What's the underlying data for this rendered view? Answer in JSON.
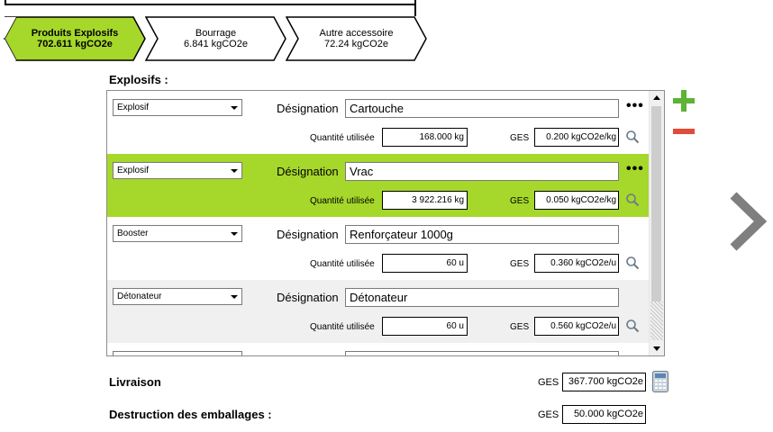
{
  "breadcrumbs": [
    {
      "title": "Produits Explosifs",
      "value": "702.611 kgCO2e",
      "active": true
    },
    {
      "title": "Bourrage",
      "value": "6.841 kgCO2e",
      "active": false
    },
    {
      "title": "Autre accessoire",
      "value": "72.24 kgCO2e",
      "active": false
    }
  ],
  "explosifs": {
    "title": "Explosifs :",
    "designation_label": "Désignation",
    "quantity_label": "Quantité utilisée",
    "ges_label": "GES",
    "more_label": "•••",
    "rows": [
      {
        "type": "Explosif",
        "designation": "Cartouche",
        "quantity": "168.000 kg",
        "ges": "0.200 kgCO2e/kg",
        "style": "white"
      },
      {
        "type": "Explosif",
        "designation": "Vrac",
        "quantity": "3 922.216 kg",
        "ges": "0.050 kgCO2e/kg",
        "style": "selected"
      },
      {
        "type": "Booster",
        "designation": "Renforçateur 1000g",
        "quantity": "60 u",
        "ges": "0.360 kgCO2e/u",
        "style": "white"
      },
      {
        "type": "Détonateur",
        "designation": "Détonateur",
        "quantity": "60 u",
        "ges": "0.560 kgCO2e/u",
        "style": "alt"
      }
    ]
  },
  "livraison": {
    "label": "Livraison",
    "ges_label": "GES",
    "value": "367.700 kgCO2e"
  },
  "destruction": {
    "label": "Destruction des emballages :",
    "ges_label": "GES",
    "value": "50.000 kgCO2e"
  },
  "colors": {
    "accent": "#a6d72b",
    "add": "#5cb335",
    "remove": "#e04b3a",
    "nav": "#7f7f7f"
  }
}
